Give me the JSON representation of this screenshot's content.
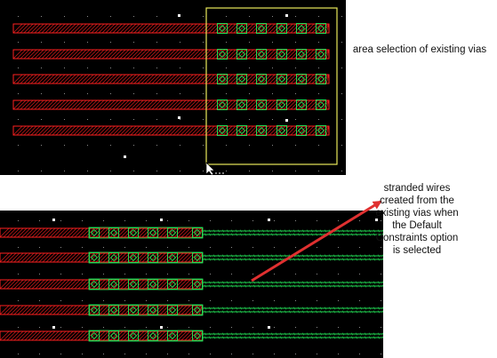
{
  "colors": {
    "canvas_background": "#000000",
    "wire_red": "#ff2020",
    "via_green": "#22dd55",
    "selection_yellow": "#e8e85a",
    "grid_dot": "#8a8a8a",
    "arrow_red": "#e03030"
  },
  "top_panel": {
    "wire_rows": 5,
    "via_columns": 6,
    "cursor_icon": "arrow-cursor-icon"
  },
  "bottom_panel": {
    "wire_rows": 5,
    "via_columns": 6,
    "stranded_wires_per_row": 2
  },
  "annotations": {
    "top_caption": "area selection of existing vias",
    "bottom_caption": "stranded wires created from the existing vias when the Default Constraints option is selected"
  }
}
